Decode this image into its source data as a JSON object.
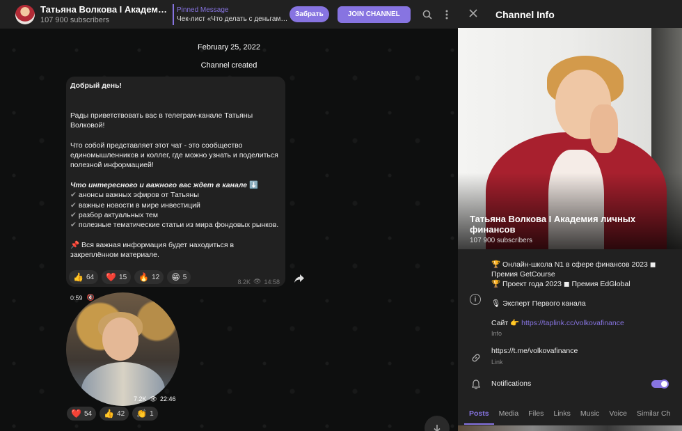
{
  "header": {
    "channel_title": "Татьяна Волкова I Академия л...",
    "subscribers": "107 900 subscribers",
    "pinned_title": "Pinned Message",
    "pinned_text": "Чек-лист «Что делать с деньгами в...",
    "take_button": "Забрать",
    "join_button": "JOIN CHANNEL"
  },
  "chat": {
    "date": "February 25, 2022",
    "created": "Channel created",
    "message": {
      "greeting": "Добрый день!",
      "p1": "Рады приветствовать вас в телеграм-канале Татьяны Волковой!",
      "p2": "Что собой представляет этот чат - это сообщество единомышленников и коллег, где можно узнать и поделиться полезной информацией!",
      "p3_title": "Что интересного и важного вас ждет в канале",
      "p3_emoji": "⬇️",
      "items": [
        "анонсы важных эфиров от Татьяны",
        "важные новости в мире инвестиций",
        "разбор актуальных тем",
        "полезные тематические статьи из мира фондовых рынков."
      ],
      "p4": "Вся важная информация будет находиться в закреплённом материале.",
      "reactions": [
        {
          "emoji": "👍",
          "count": "64"
        },
        {
          "emoji": "❤️",
          "count": "15"
        },
        {
          "emoji": "🔥",
          "count": "12"
        },
        {
          "emoji": "😁",
          "count": "5"
        }
      ],
      "views": "8.2K",
      "time": "14:58"
    },
    "video": {
      "duration": "0:59",
      "views": "7.2K",
      "time": "22:46",
      "reactions": [
        {
          "emoji": "❤️",
          "count": "54"
        },
        {
          "emoji": "👍",
          "count": "42"
        },
        {
          "emoji": "👏",
          "count": "1"
        }
      ]
    }
  },
  "panel": {
    "title": "Channel Info",
    "channel_name": "Татьяна Волкова I Академия личных финансов",
    "subscribers": "107 900 subscribers",
    "info_line1": "🏆 Онлайн-школа N1 в сфере финансов 2023 ◼ Премия GetCourse",
    "info_line2": "🏆 Проект года 2023 ◼ Премия EdGlobal",
    "info_line3": "🎙 Эксперт Первого канала",
    "info_site_label": "Сайт 👉",
    "info_site_link": "https://taplink.cc/volkovafinance",
    "info_label": "Info",
    "link_text": "https://t.me/volkovafinance",
    "link_label": "Link",
    "notifications": "Notifications",
    "tabs": [
      "Posts",
      "Media",
      "Files",
      "Links",
      "Music",
      "Voice",
      "Similar Ch"
    ]
  },
  "colors": {
    "accent": "#8774e1",
    "panel_bg": "#212121",
    "chat_bg": "#0e0f0f"
  }
}
